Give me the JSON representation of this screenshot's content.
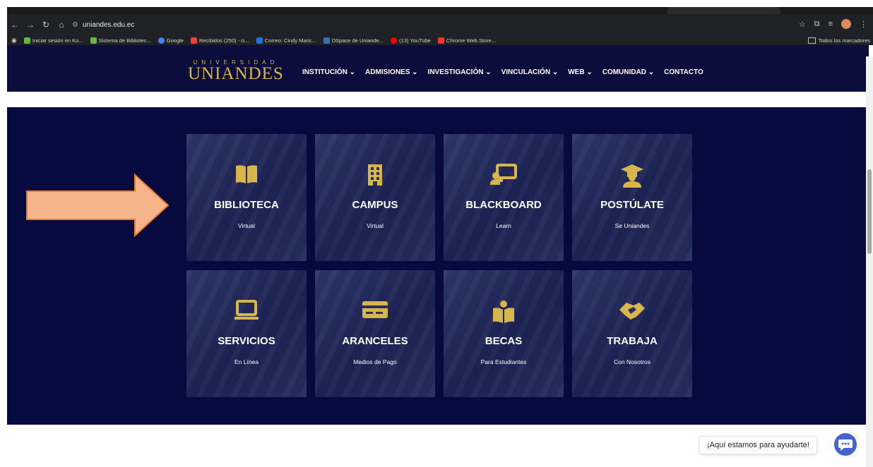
{
  "browser": {
    "url": "uniandes.edu.ec",
    "bookmarks": [
      {
        "label": "Iniciar sesión en Ko...",
        "color": "#6bb548"
      },
      {
        "label": "Sistema de Bibliotec...",
        "color": "#6bb548"
      },
      {
        "label": "Google",
        "color": "#4285f4"
      },
      {
        "label": "Recibidos (250) - ci...",
        "color": "#ea4335"
      },
      {
        "label": "Correo: Cindy Maric...",
        "color": "#1a73e8"
      },
      {
        "label": "DSpace de Uniande...",
        "color": "#3b6fb6"
      },
      {
        "label": "(13) YouTube",
        "color": "#ff0000"
      },
      {
        "label": "Chrome Web Store...",
        "color": "#e53935"
      }
    ],
    "all_bookmarks": "Todos los marcadores"
  },
  "header": {
    "logo_small": "UNIVERSIDAD",
    "logo_big": "UNIANDES",
    "menu": [
      {
        "label": "INSTITUCIÓN ⌄"
      },
      {
        "label": "ADMISIONES ⌄"
      },
      {
        "label": "INVESTIGACIÓN ⌄"
      },
      {
        "label": "VINCULACIÓN ⌄"
      },
      {
        "label": "WEB ⌄"
      },
      {
        "label": "COMUNIDAD ⌄"
      },
      {
        "label": "CONTACTO"
      }
    ]
  },
  "tiles": [
    {
      "title": "BIBLIOTECA",
      "subtitle": "Virtual",
      "icon": "book-icon"
    },
    {
      "title": "CAMPUS",
      "subtitle": "Virtual",
      "icon": "building-icon"
    },
    {
      "title": "BLACKBOARD",
      "subtitle": "Learn",
      "icon": "teacher-board-icon"
    },
    {
      "title": "POSTÚLATE",
      "subtitle": "Se Uniandes",
      "icon": "graduate-icon"
    },
    {
      "title": "SERVICIOS",
      "subtitle": "En Línea",
      "icon": "laptop-icon"
    },
    {
      "title": "ARANCELES",
      "subtitle": "Medios de Pago",
      "icon": "credit-card-icon"
    },
    {
      "title": "BECAS",
      "subtitle": "Para Estudiantes",
      "icon": "reading-person-icon"
    },
    {
      "title": "TRABAJA",
      "subtitle": "Con Nosotros",
      "icon": "handshake-icon"
    }
  ],
  "chat": {
    "text": "¡Aquí estamos para ayudarte!"
  },
  "colors": {
    "navy": "#070a3e",
    "gold": "#d9b64a",
    "arrow": "#f7b58c",
    "arrow_border": "#f07a28",
    "chat": "#4262d6"
  }
}
